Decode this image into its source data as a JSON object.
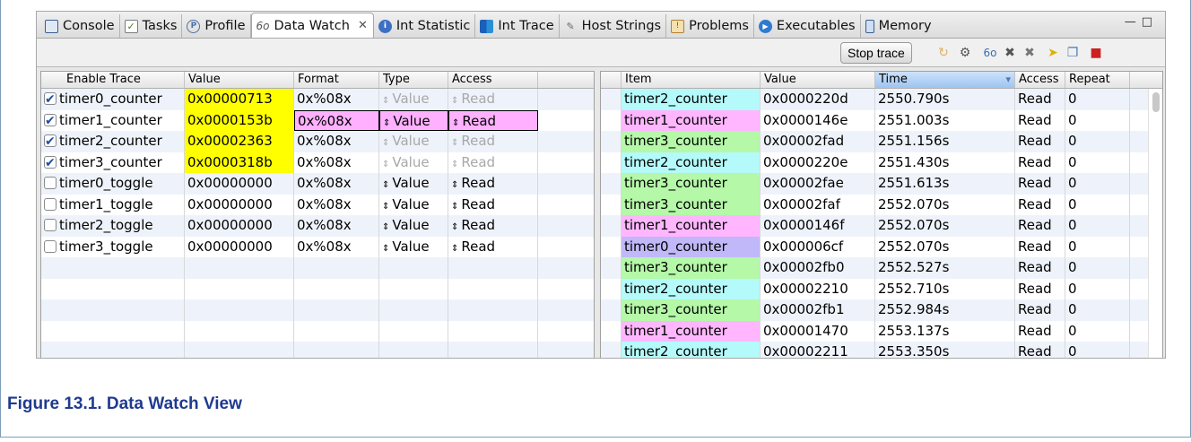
{
  "tabs": [
    {
      "label": "Console",
      "icon": "console-icon"
    },
    {
      "label": "Tasks",
      "icon": "tasks-icon"
    },
    {
      "label": "Profile",
      "icon": "profile-icon"
    },
    {
      "label": "Data Watch",
      "icon": "data-watch-icon",
      "active": true
    },
    {
      "label": "Int Statistic",
      "icon": "info-icon"
    },
    {
      "label": "Int Trace",
      "icon": "bar-chart-icon"
    },
    {
      "label": "Host Strings",
      "icon": "host-strings-icon"
    },
    {
      "label": "Problems",
      "icon": "problems-icon"
    },
    {
      "label": "Executables",
      "icon": "executables-icon"
    },
    {
      "label": "Memory",
      "icon": "memory-icon"
    }
  ],
  "toolbar": {
    "stop_trace": "Stop trace"
  },
  "left_table": {
    "headers": [
      "Enable Trace",
      "Value",
      "Format",
      "Type",
      "Access"
    ],
    "rows": [
      {
        "name": "timer0_counter",
        "value": "0x00000713",
        "format": "0x%08x",
        "type": "Value",
        "access": "Read",
        "checked": true
      },
      {
        "name": "timer1_counter",
        "value": "0x0000153b",
        "format": "0x%08x",
        "type": "Value",
        "access": "Read",
        "checked": true
      },
      {
        "name": "timer2_counter",
        "value": "0x00002363",
        "format": "0x%08x",
        "type": "Value",
        "access": "Read",
        "checked": true
      },
      {
        "name": "timer3_counter",
        "value": "0x0000318b",
        "format": "0x%08x",
        "type": "Value",
        "access": "Read",
        "checked": true
      },
      {
        "name": "timer0_toggle",
        "value": "0x00000000",
        "format": "0x%08x",
        "type": "Value",
        "access": "Read",
        "checked": false
      },
      {
        "name": "timer1_toggle",
        "value": "0x00000000",
        "format": "0x%08x",
        "type": "Value",
        "access": "Read",
        "checked": false
      },
      {
        "name": "timer2_toggle",
        "value": "0x00000000",
        "format": "0x%08x",
        "type": "Value",
        "access": "Read",
        "checked": false
      },
      {
        "name": "timer3_toggle",
        "value": "0x00000000",
        "format": "0x%08x",
        "type": "Value",
        "access": "Read",
        "checked": false
      }
    ]
  },
  "right_table": {
    "headers": [
      "Item",
      "Value",
      "Time",
      "Access",
      "Repeat"
    ],
    "rows": [
      {
        "item": "timer2_counter",
        "value": "0x0000220d",
        "time": "2550.790s",
        "access": "Read",
        "repeat": "0"
      },
      {
        "item": "timer1_counter",
        "value": "0x0000146e",
        "time": "2551.003s",
        "access": "Read",
        "repeat": "0"
      },
      {
        "item": "timer3_counter",
        "value": "0x00002fad",
        "time": "2551.156s",
        "access": "Read",
        "repeat": "0"
      },
      {
        "item": "timer2_counter",
        "value": "0x0000220e",
        "time": "2551.430s",
        "access": "Read",
        "repeat": "0"
      },
      {
        "item": "timer3_counter",
        "value": "0x00002fae",
        "time": "2551.613s",
        "access": "Read",
        "repeat": "0"
      },
      {
        "item": "timer3_counter",
        "value": "0x00002faf",
        "time": "2552.070s",
        "access": "Read",
        "repeat": "0"
      },
      {
        "item": "timer1_counter",
        "value": "0x0000146f",
        "time": "2552.070s",
        "access": "Read",
        "repeat": "0"
      },
      {
        "item": "timer0_counter",
        "value": "0x000006cf",
        "time": "2552.070s",
        "access": "Read",
        "repeat": "0"
      },
      {
        "item": "timer3_counter",
        "value": "0x00002fb0",
        "time": "2552.527s",
        "access": "Read",
        "repeat": "0"
      },
      {
        "item": "timer2_counter",
        "value": "0x00002210",
        "time": "2552.710s",
        "access": "Read",
        "repeat": "0"
      },
      {
        "item": "timer3_counter",
        "value": "0x00002fb1",
        "time": "2552.984s",
        "access": "Read",
        "repeat": "0"
      },
      {
        "item": "timer1_counter",
        "value": "0x00001470",
        "time": "2553.137s",
        "access": "Read",
        "repeat": "0"
      },
      {
        "item": "timer2_counter",
        "value": "0x00002211",
        "time": "2553.350s",
        "access": "Read",
        "repeat": "0"
      }
    ]
  },
  "colors": {
    "timer0": "#c0b8f8",
    "timer1": "#ffb6ff",
    "timer2": "#b4fafa",
    "timer3": "#b4f8a8",
    "highlight": "#ffff00"
  },
  "caption": "Figure 13.1. Data Watch View"
}
